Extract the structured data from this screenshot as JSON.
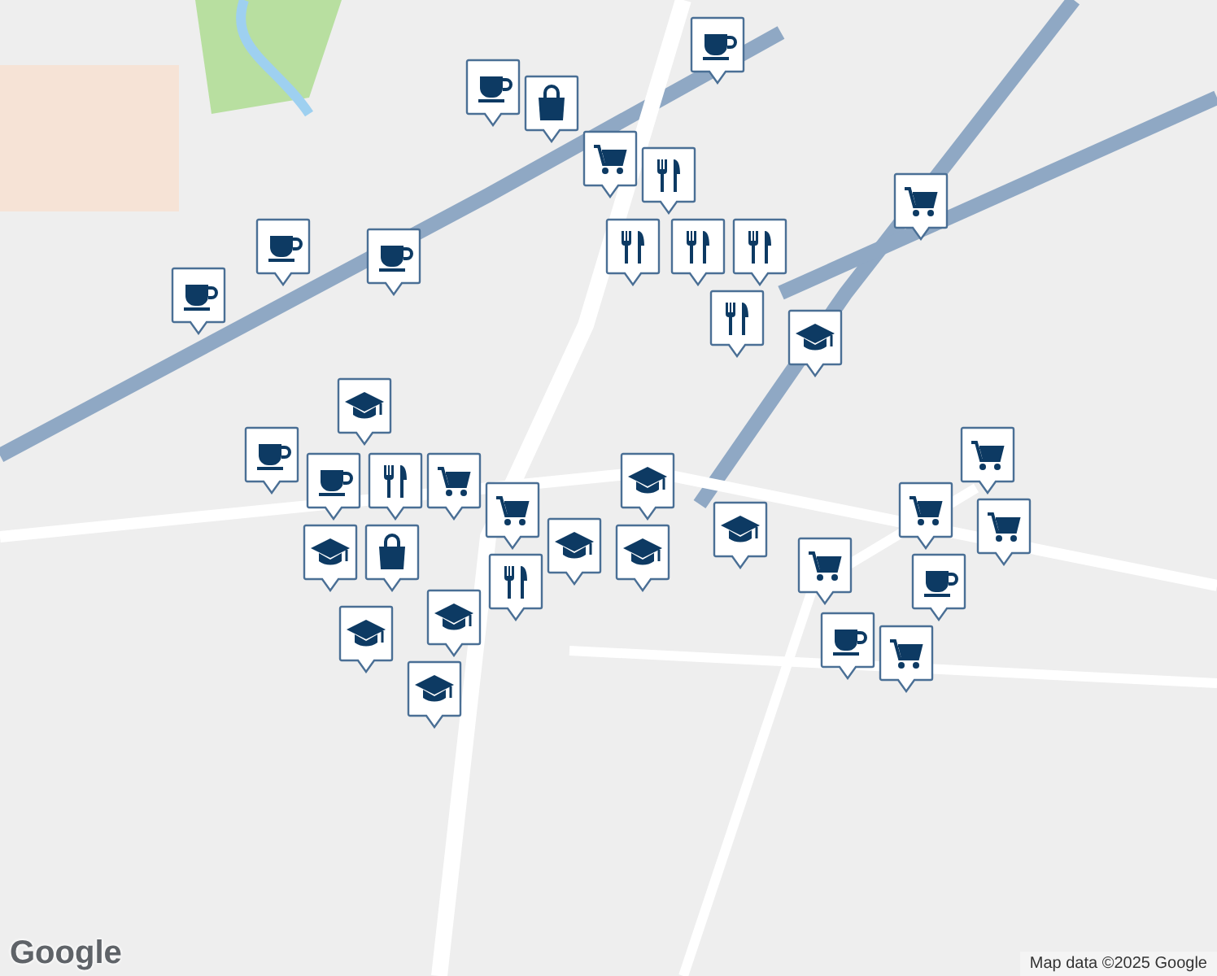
{
  "markers": [
    {
      "kind": "cafe"
    },
    {
      "kind": "cafe"
    },
    {
      "kind": "shopping"
    },
    {
      "kind": "cart"
    },
    {
      "kind": "restaurant"
    },
    {
      "kind": "restaurant"
    },
    {
      "kind": "restaurant"
    },
    {
      "kind": "restaurant"
    },
    {
      "kind": "restaurant"
    },
    {
      "kind": "cart"
    },
    {
      "kind": "school"
    },
    {
      "kind": "cafe"
    },
    {
      "kind": "cafe"
    },
    {
      "kind": "cafe"
    },
    {
      "kind": "school"
    },
    {
      "kind": "cafe"
    },
    {
      "kind": "cafe"
    },
    {
      "kind": "restaurant"
    },
    {
      "kind": "cart"
    },
    {
      "kind": "cart"
    },
    {
      "kind": "shopping"
    },
    {
      "kind": "school"
    },
    {
      "kind": "restaurant"
    },
    {
      "kind": "school"
    },
    {
      "kind": "school"
    },
    {
      "kind": "school"
    },
    {
      "kind": "school"
    },
    {
      "kind": "school"
    },
    {
      "kind": "cart"
    },
    {
      "kind": "school"
    },
    {
      "kind": "school"
    },
    {
      "kind": "cart"
    },
    {
      "kind": "cart"
    },
    {
      "kind": "cart"
    },
    {
      "kind": "cafe"
    },
    {
      "kind": "cafe"
    },
    {
      "kind": "cart"
    }
  ],
  "logo": "Google",
  "attribution": "Map data ©2025 Google"
}
